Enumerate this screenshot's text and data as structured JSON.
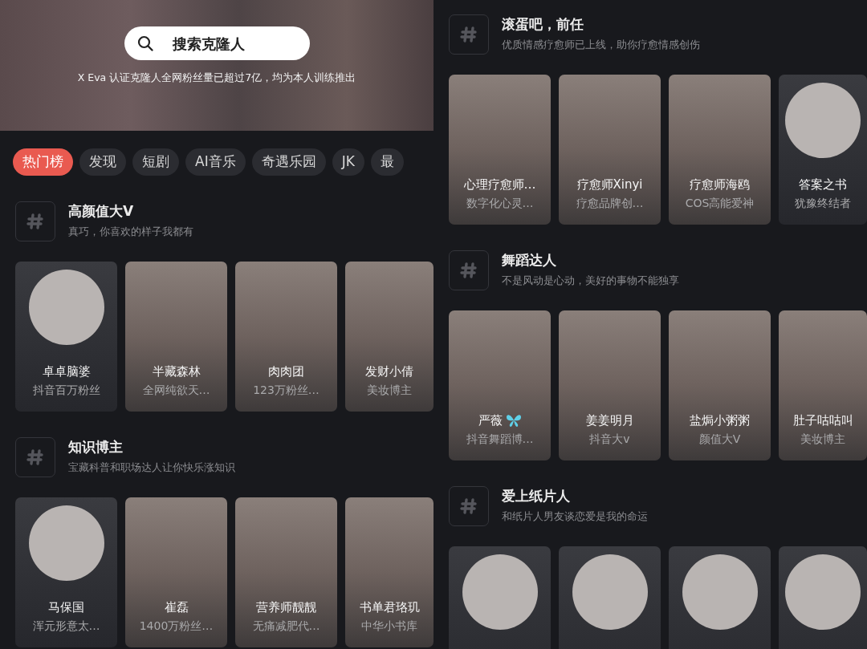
{
  "panels": [
    {
      "banner": {
        "search_label": "搜索克隆人",
        "caption": "X Eva 认证克隆人全网粉丝量已超过7亿，均为本人训练推出"
      },
      "tabs": [
        {
          "label": "热门榜",
          "selected": true
        },
        {
          "label": "发现",
          "selected": false
        },
        {
          "label": "短剧",
          "selected": false
        },
        {
          "label": "AI音乐",
          "selected": false
        },
        {
          "label": "奇遇乐园",
          "selected": false
        },
        {
          "label": "JK",
          "selected": false
        },
        {
          "label": "最",
          "selected": false
        }
      ],
      "sections": [
        {
          "title": "高颜值大V",
          "subtitle": "真巧，你喜欢的样子我都有",
          "cards": [
            {
              "kind": "avatar",
              "name": "卓卓脑婆",
              "subtitle": "抖音百万粉丝"
            },
            {
              "kind": "photo",
              "name": "半藏森林",
              "subtitle": "全网纯欲天…"
            },
            {
              "kind": "photo",
              "name": "肉肉团",
              "subtitle": "123万粉丝…"
            },
            {
              "kind": "photo",
              "name": "发财小倩",
              "subtitle": "美妆博主"
            }
          ]
        },
        {
          "title": "知识博主",
          "subtitle": "宝藏科普和职场达人让你快乐涨知识",
          "cards": [
            {
              "kind": "avatar",
              "name": "马保国",
              "subtitle": "浑元形意太…"
            },
            {
              "kind": "photo",
              "name": "崔磊",
              "subtitle": "1400万粉丝…"
            },
            {
              "kind": "photo",
              "name": "营养师靓靓",
              "subtitle": "无痛减肥代…"
            },
            {
              "kind": "photo",
              "name": "书单君珞玑",
              "subtitle": "中华小书库"
            }
          ]
        }
      ]
    },
    {
      "sections": [
        {
          "title": "滚蛋吧，前任",
          "subtitle": "优质情感疗愈师已上线，助你疗愈情感创伤",
          "cards": [
            {
              "kind": "photo",
              "name": "心理疗愈师…",
              "subtitle": "数字化心灵…"
            },
            {
              "kind": "photo",
              "name": "疗愈师Xinyi",
              "subtitle": "疗愈品牌创…"
            },
            {
              "kind": "photo",
              "name": "疗愈师海鸥",
              "subtitle": "COS高能爱神"
            },
            {
              "kind": "avatar",
              "name": "答案之书",
              "subtitle": "犹豫终结者"
            }
          ]
        },
        {
          "title": "舞蹈达人",
          "subtitle": "不是风动是心动，美好的事物不能独享",
          "cards": [
            {
              "kind": "photo",
              "name": "严薇",
              "has_name_icon": true,
              "subtitle": "抖音舞蹈博…"
            },
            {
              "kind": "photo",
              "name": "姜姜明月",
              "subtitle": "抖音大v"
            },
            {
              "kind": "photo",
              "name": "盐焗小粥粥",
              "subtitle": "颜值大V"
            },
            {
              "kind": "photo",
              "name": "肚子咕咕叫",
              "subtitle": "美妆博主"
            }
          ]
        },
        {
          "title": "爱上纸片人",
          "subtitle": "和纸片人男友谈恋爱是我的命运",
          "cards": [
            {
              "kind": "avatar"
            },
            {
              "kind": "avatar"
            },
            {
              "kind": "avatar"
            },
            {
              "kind": "avatar"
            }
          ]
        }
      ]
    }
  ]
}
